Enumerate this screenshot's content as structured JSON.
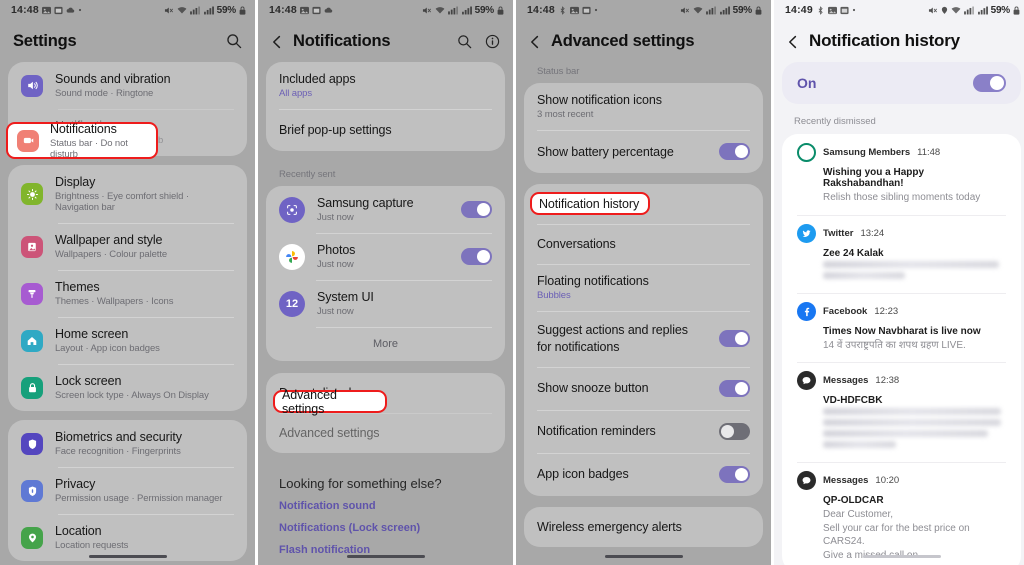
{
  "screens": [
    {
      "id": "settings",
      "statusbar": {
        "clock": "14:48",
        "battery": "59%",
        "icons": [
          "image-icon",
          "calendar-icon",
          "cloud-icon",
          "dot-icon"
        ],
        "right_icons": [
          "mute-icon",
          "wifi-icon",
          "signal-icon",
          "signal-bars-icon",
          "lock-icon"
        ]
      },
      "header": {
        "title": "Settings",
        "search_icon": "search-icon"
      },
      "groups": [
        {
          "items": [
            {
              "icon": "volume-icon",
              "color": "#6f63c4",
              "title": "Sounds and vibration",
              "sub": "Sound mode  ·  Ringtone"
            },
            {
              "icon": "notification-bell-icon",
              "color": "#f08075",
              "title": "Notifications",
              "sub": "Status bar  ·  Do not disturb",
              "highlighted": true
            }
          ]
        },
        {
          "items": [
            {
              "icon": "brightness-icon",
              "color": "#81b52c",
              "title": "Display",
              "sub": "Brightness  ·  Eye comfort shield  ·  Navigation bar"
            },
            {
              "icon": "wallpaper-icon",
              "color": "#cc5478",
              "title": "Wallpaper and style",
              "sub": "Wallpapers  ·  Colour palette"
            },
            {
              "icon": "brush-icon",
              "color": "#a75bd1",
              "title": "Themes",
              "sub": "Themes  ·  Wallpapers  ·  Icons"
            },
            {
              "icon": "home-icon",
              "color": "#2fa9c4",
              "title": "Home screen",
              "sub": "Layout  ·  App icon badges"
            },
            {
              "icon": "lock-icon",
              "color": "#16a07b",
              "title": "Lock screen",
              "sub": "Screen lock type  ·  Always On Display"
            }
          ]
        },
        {
          "items": [
            {
              "icon": "shield-icon",
              "color": "#5446bf",
              "title": "Biometrics and security",
              "sub": "Face recognition  ·  Fingerprints"
            },
            {
              "icon": "privacy-hand-icon",
              "color": "#5f79d4",
              "title": "Privacy",
              "sub": "Permission usage  ·  Permission manager"
            },
            {
              "icon": "location-pin-icon",
              "color": "#45a34a",
              "title": "Location",
              "sub": "Location requests"
            }
          ]
        }
      ]
    },
    {
      "id": "notifications",
      "statusbar": {
        "clock": "14:48",
        "battery": "59%"
      },
      "header": {
        "title": "Notifications",
        "back_icon": "back-arrow-icon",
        "search_icon": "search-icon",
        "info_icon": "info-icon"
      },
      "top_items": [
        {
          "title": "Included apps",
          "sub": "All apps"
        },
        {
          "title": "Brief pop-up settings",
          "sub": ""
        }
      ],
      "recently_sent_label": "Recently sent",
      "recently_sent": [
        {
          "app": "Samsung capture",
          "time": "Just now",
          "toggle": true,
          "icon": "samsung-capture-icon",
          "color": "#6f63c4"
        },
        {
          "app": "Photos",
          "time": "Just now",
          "toggle": true,
          "icon": "google-photos-icon",
          "color": "#ffffff"
        },
        {
          "app": "System UI",
          "time": "Just now",
          "toggle": false,
          "icon": "system-ui-icon",
          "color": "#6f63c4"
        }
      ],
      "more_label": "More",
      "bottom_items": [
        {
          "title": "Do not disturb"
        },
        {
          "title": "Advanced settings",
          "highlighted": true
        }
      ],
      "looking_for_label": "Looking for something else?",
      "links": [
        "Notification sound",
        "Notifications (Lock screen)",
        "Flash notification"
      ]
    },
    {
      "id": "advanced",
      "statusbar": {
        "clock": "14:48",
        "battery": "59%"
      },
      "header": {
        "title": "Advanced settings",
        "back_icon": "back-arrow-icon"
      },
      "section_label": "Status bar",
      "statusbar_items": [
        {
          "title": "Show notification icons",
          "sub": "3 most recent"
        },
        {
          "title": "Show battery percentage",
          "sub": "",
          "toggle": true
        }
      ],
      "main_items": [
        {
          "title": "Notification history",
          "sub": "",
          "highlighted": true
        },
        {
          "title": "Conversations",
          "sub": ""
        },
        {
          "title": "Floating notifications",
          "sub": "Bubbles"
        },
        {
          "title": "Suggest actions and replies for notifications",
          "sub": "",
          "toggle": true
        },
        {
          "title": "Show snooze button",
          "sub": "",
          "toggle": true
        },
        {
          "title": "Notification reminders",
          "sub": "",
          "toggle": false
        },
        {
          "title": "App icon badges",
          "sub": "",
          "toggle": true
        }
      ],
      "last_items": [
        {
          "title": "Wireless emergency alerts"
        }
      ]
    },
    {
      "id": "history",
      "statusbar": {
        "clock": "14:49",
        "battery": "59%"
      },
      "header": {
        "title": "Notification history",
        "back_icon": "back-arrow-icon"
      },
      "toggle_label": "On",
      "toggle_on": true,
      "recently_dismissed_label": "Recently dismissed",
      "notifications": [
        {
          "app": "Samsung Members",
          "time": "11:48",
          "icon": "samsung-members-icon",
          "color": "#0a8c6a",
          "title": "Wishing you a Happy Rakshabandhan!",
          "body": "Relish those sibling moments today",
          "blurred": false
        },
        {
          "app": "Twitter",
          "time": "13:24",
          "icon": "twitter-icon",
          "color": "#1d9bf0",
          "title": "Zee 24 Kalak",
          "body": "",
          "blurred": true,
          "blur_lines": 2
        },
        {
          "app": "Facebook",
          "time": "12:23",
          "icon": "facebook-icon",
          "color": "#1877f2",
          "title": "Times Now Navbharat is live now",
          "body": "14 वें उपराष्ट्रपति का शपथ ग्रहण LIVE.",
          "blurred": false
        },
        {
          "app": "Messages",
          "time": "12:38",
          "icon": "messages-icon",
          "color": "#2b2b2b",
          "title": "VD-HDFCBK",
          "body": "",
          "blurred": true,
          "blur_lines": 4
        },
        {
          "app": "Messages",
          "time": "10:20",
          "icon": "messages-icon",
          "color": "#2b2b2b",
          "title": "QP-OLDCAR",
          "body": "Dear Customer,\nSell your car for the best price on CARS24.\nGive a missed call on",
          "blurred": false
        }
      ]
    }
  ]
}
